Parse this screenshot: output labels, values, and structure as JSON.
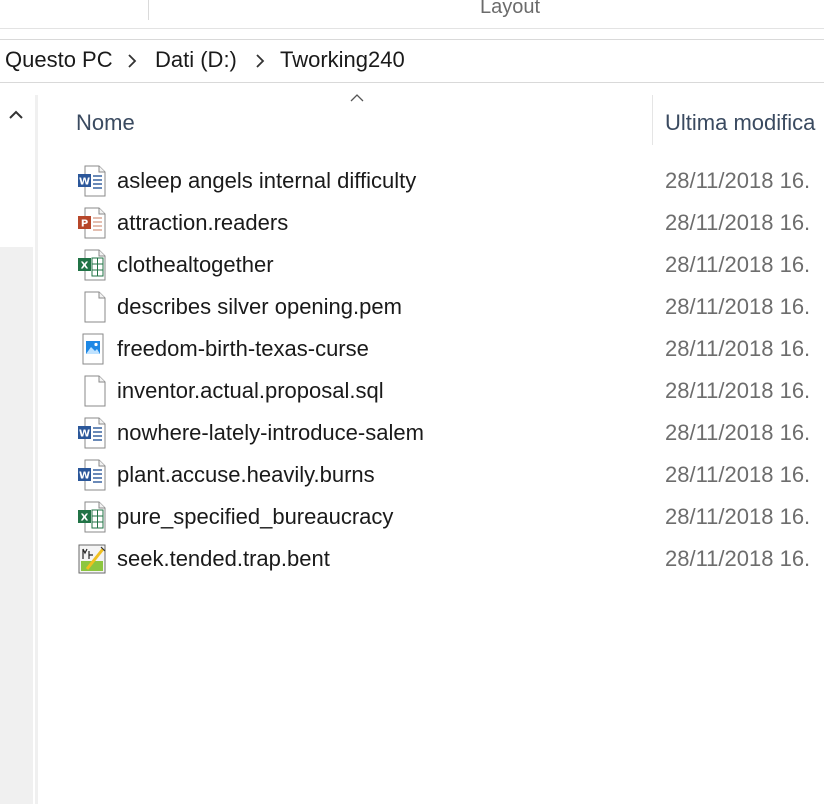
{
  "ribbon": {
    "group_label": "Layout"
  },
  "breadcrumb": {
    "items": [
      "Questo PC",
      "Dati (D:)",
      "Tworking240"
    ]
  },
  "columns": {
    "name": "Nome",
    "modified": "Ultima modifica"
  },
  "files": [
    {
      "name": "asleep angels internal difficulty",
      "modified": "28/11/2018 16.",
      "icon": "word-document-icon"
    },
    {
      "name": "attraction.readers",
      "modified": "28/11/2018 16.",
      "icon": "powerpoint-document-icon"
    },
    {
      "name": "clothealtogether",
      "modified": "28/11/2018 16.",
      "icon": "excel-document-icon"
    },
    {
      "name": "describes silver opening.pem",
      "modified": "28/11/2018 16.",
      "icon": "generic-file-icon"
    },
    {
      "name": "freedom-birth-texas-curse",
      "modified": "28/11/2018 16.",
      "icon": "image-file-icon"
    },
    {
      "name": "inventor.actual.proposal.sql",
      "modified": "28/11/2018 16.",
      "icon": "generic-file-icon"
    },
    {
      "name": "nowhere-lately-introduce-salem",
      "modified": "28/11/2018 16.",
      "icon": "word-document-icon"
    },
    {
      "name": "plant.accuse.heavily.burns",
      "modified": "28/11/2018 16.",
      "icon": "word-document-icon"
    },
    {
      "name": "pure_specified_bureaucracy",
      "modified": "28/11/2018 16.",
      "icon": "excel-document-icon"
    },
    {
      "name": "seek.tended.trap.bent",
      "modified": "28/11/2018 16.",
      "icon": "script-file-icon"
    }
  ],
  "colors": {
    "word": "#2b579a",
    "powerpoint": "#b7472a",
    "excel": "#217346",
    "image": "#1e88e5",
    "header_text": "#3a4a60",
    "date_text": "#6d6d6d"
  }
}
